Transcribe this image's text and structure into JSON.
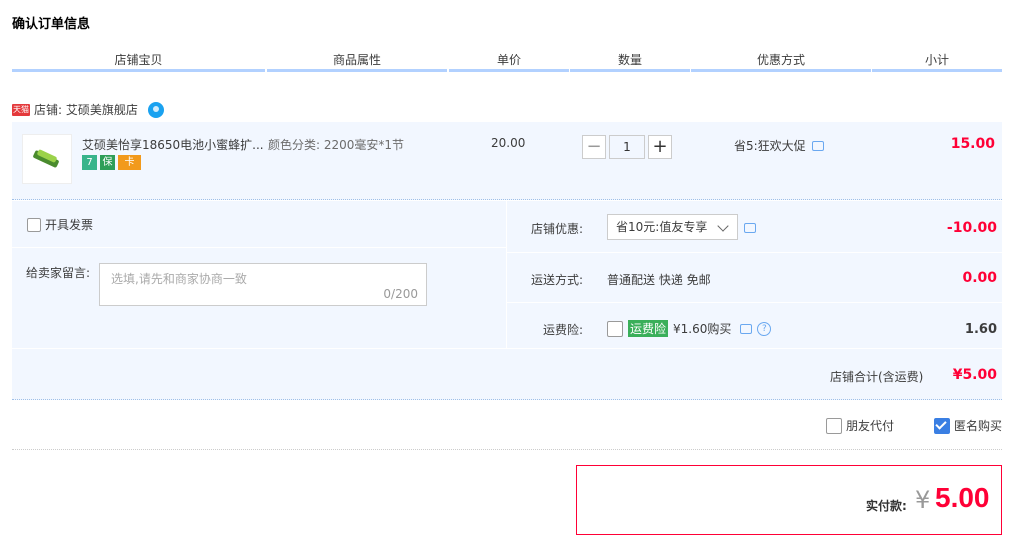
{
  "page_title": "确认订单信息",
  "columns": [
    "店铺宝贝",
    "商品属性",
    "单价",
    "数量",
    "优惠方式",
    "小计"
  ],
  "shop": {
    "badge": "天猫",
    "label": "店铺: 艾硕美旗舰店",
    "ww_icon": "wangwang-icon"
  },
  "item": {
    "name": "艾硕美怡享18650电池小蜜蜂扩...",
    "attr": "颜色分类: 2200毫安*1节",
    "price": "20.00",
    "quantity": "1",
    "promo": "省5:狂欢大促",
    "subtotal": "15.00",
    "service_icons": [
      "7",
      "保",
      "卡"
    ]
  },
  "invoice": {
    "label": "开具发票"
  },
  "memo": {
    "label": "给卖家留言:",
    "placeholder": "选填,请先和商家协商一致",
    "count": "0/200"
  },
  "shop_discount": {
    "label": "店铺优惠:",
    "selected": "省10元:值友专享",
    "amount": "-10.00"
  },
  "shipping": {
    "label": "运送方式:",
    "value": "普通配送 快递 免邮",
    "amount": "0.00"
  },
  "insurance": {
    "label": "运费险:",
    "tag": "运费险",
    "text": "¥1.60购买",
    "amount": "1.60"
  },
  "shop_total": {
    "label": "店铺合计(含运费)",
    "amount": "¥5.00"
  },
  "options": {
    "friend_pay": "朋友代付",
    "anonymous": "匿名购买"
  },
  "pay": {
    "label": "实付款:",
    "currency": "¥",
    "amount": "5.00"
  },
  "colors": {
    "accent_red": "#ff0036",
    "header_bar": "#b2d1ff",
    "row_bg": "#f2f7ff"
  }
}
